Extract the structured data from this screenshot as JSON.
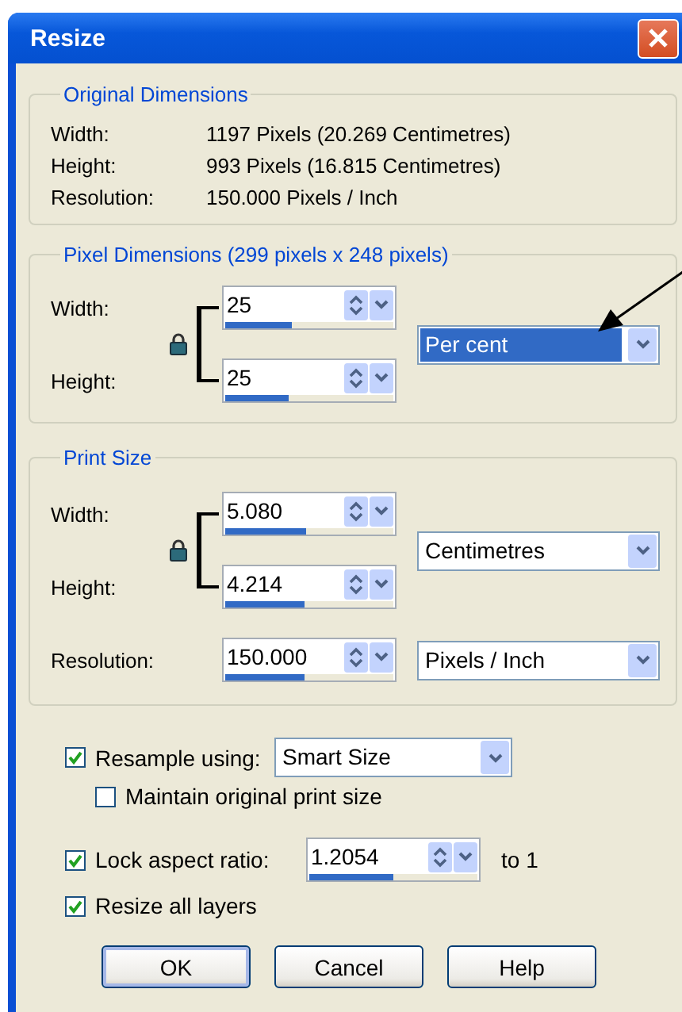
{
  "window": {
    "title": "Resize"
  },
  "original_dimensions": {
    "title": "Original Dimensions",
    "rows": [
      {
        "label": "Width:",
        "value": "1197 Pixels (20.269 Centimetres)"
      },
      {
        "label": "Height:",
        "value": "993 Pixels (16.815 Centimetres)"
      },
      {
        "label": "Resolution:",
        "value": "150.000 Pixels / Inch"
      }
    ]
  },
  "pixel_dimensions": {
    "title": "Pixel Dimensions (299 pixels x 248 pixels)",
    "locked": true,
    "fields": [
      {
        "label": "Width:",
        "value": "25",
        "level": 0.4
      },
      {
        "label": "Height:",
        "value": "25",
        "level": 0.38
      }
    ],
    "unit": {
      "value": "Per cent",
      "focused": true
    }
  },
  "print_size": {
    "title": "Print Size",
    "locked": true,
    "fields": [
      {
        "label": "Width:",
        "value": "5.080",
        "level": 0.48
      },
      {
        "label": "Height:",
        "value": "4.214",
        "level": 0.47
      }
    ],
    "unit": {
      "value": "Centimetres",
      "focused": false
    },
    "resolution": {
      "label": "Resolution:",
      "value": "150.000",
      "level": 0.47,
      "unit": {
        "value": "Pixels / Inch",
        "focused": false
      }
    }
  },
  "options": [
    {
      "kind": "combo",
      "label": "Resample using:",
      "checked": true,
      "value": "Smart Size",
      "children": [
        {
          "kind": "check",
          "label": "Maintain original print size",
          "checked": false
        }
      ]
    },
    {
      "kind": "spin",
      "label": "Lock aspect ratio:",
      "checked": true,
      "value": "1.2054",
      "level": 0.5,
      "suffix": "to 1"
    },
    {
      "kind": "check",
      "label": "Resize all layers",
      "checked": true
    }
  ],
  "buttons": [
    {
      "label": "OK",
      "default": true
    },
    {
      "label": "Cancel",
      "default": false
    },
    {
      "label": "Help",
      "default": false
    }
  ]
}
